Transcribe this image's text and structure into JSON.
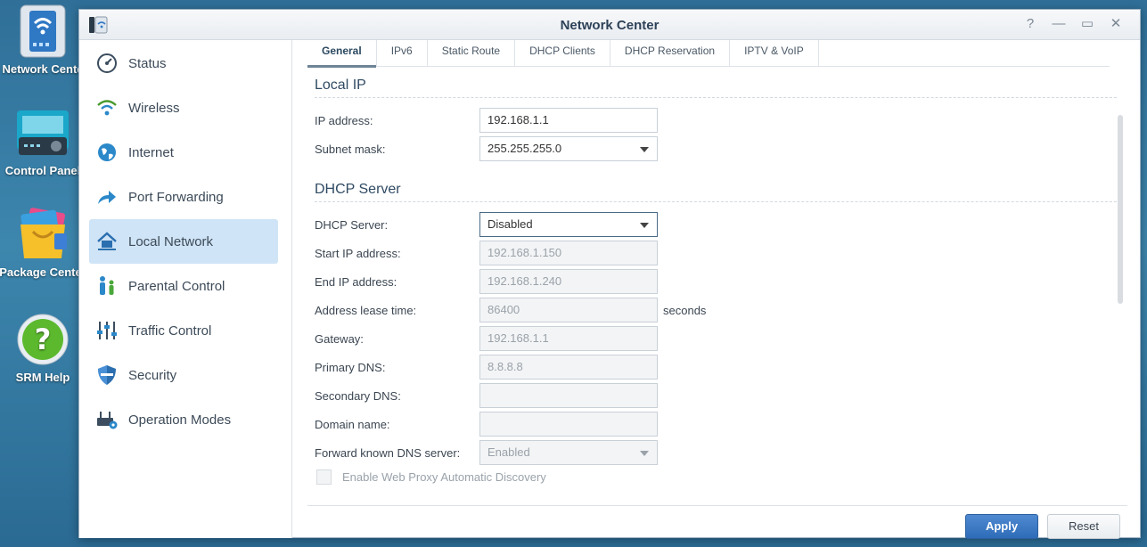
{
  "desktop": {
    "icons": [
      {
        "label": "Network Cente"
      },
      {
        "label": "Control Panel"
      },
      {
        "label": "Package Center"
      },
      {
        "label": "SRM Help"
      }
    ]
  },
  "window": {
    "title": "Network Center",
    "controls": {
      "help": "?",
      "minimize": "—",
      "maximize": "▭",
      "close": "✕"
    }
  },
  "sidebar": {
    "items": [
      {
        "label": "Status",
        "icon": "gauge-icon"
      },
      {
        "label": "Wireless",
        "icon": "wifi-icon"
      },
      {
        "label": "Internet",
        "icon": "globe-icon"
      },
      {
        "label": "Port Forwarding",
        "icon": "forward-arrow-icon"
      },
      {
        "label": "Local Network",
        "icon": "home-network-icon",
        "active": true
      },
      {
        "label": "Parental Control",
        "icon": "family-icon"
      },
      {
        "label": "Traffic Control",
        "icon": "sliders-icon"
      },
      {
        "label": "Security",
        "icon": "shield-icon"
      },
      {
        "label": "Operation Modes",
        "icon": "router-gear-icon"
      }
    ]
  },
  "tabs": [
    {
      "label": "General",
      "active": true
    },
    {
      "label": "IPv6"
    },
    {
      "label": "Static Route"
    },
    {
      "label": "DHCP Clients"
    },
    {
      "label": "DHCP Reservation"
    },
    {
      "label": "IPTV & VoIP"
    }
  ],
  "local_ip": {
    "title": "Local IP",
    "ip_label": "IP address:",
    "ip_value": "192.168.1.1",
    "mask_label": "Subnet mask:",
    "mask_value": "255.255.255.0"
  },
  "dhcp": {
    "title": "DHCP Server",
    "server_label": "DHCP Server:",
    "server_value": "Disabled",
    "start_label": "Start IP address:",
    "start_value": "192.168.1.150",
    "end_label": "End IP address:",
    "end_value": "192.168.1.240",
    "lease_label": "Address lease time:",
    "lease_value": "86400",
    "lease_suffix": "seconds",
    "gateway_label": "Gateway:",
    "gateway_value": "192.168.1.1",
    "pdns_label": "Primary DNS:",
    "pdns_value": "8.8.8.8",
    "sdns_label": "Secondary DNS:",
    "sdns_value": "",
    "domain_label": "Domain name:",
    "domain_value": "",
    "fwd_label": "Forward known DNS server:",
    "fwd_value": "Enabled",
    "proxy_label": "Enable Web Proxy Automatic Discovery"
  },
  "footer": {
    "apply": "Apply",
    "reset": "Reset"
  }
}
